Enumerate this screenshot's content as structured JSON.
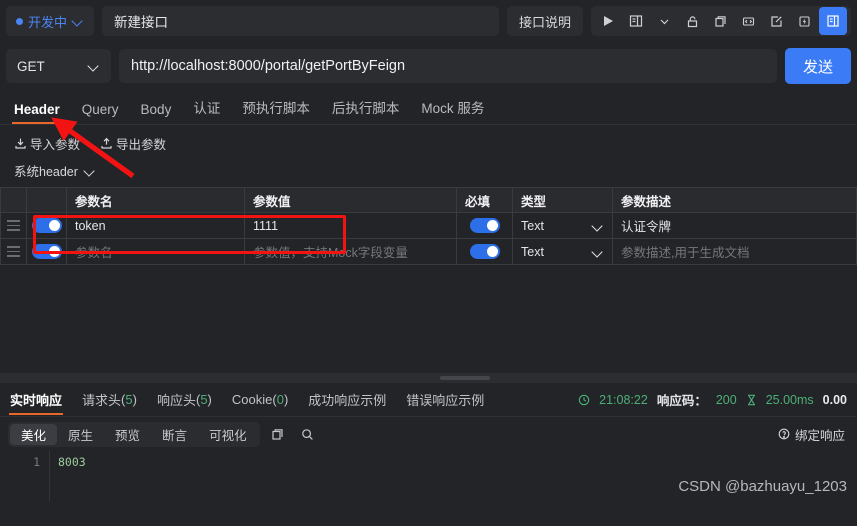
{
  "topbar": {
    "status_label": "开发中",
    "status_color": "#4a85f5",
    "title_value": "新建接口",
    "doc_button": "接口说明",
    "icons": [
      "run-icon",
      "doc-list-icon",
      "chevron-down-icon",
      "lock-icon",
      "copy-icon",
      "code-icon",
      "share-icon",
      "flash-icon",
      "save-icon"
    ]
  },
  "request": {
    "method": "GET",
    "url": "http://localhost:8000/portal/getPortByFeign",
    "send_label": "发送"
  },
  "tabs": [
    {
      "label": "Header",
      "active": true
    },
    {
      "label": "Query",
      "active": false
    },
    {
      "label": "Body",
      "active": false
    },
    {
      "label": "认证",
      "active": false
    },
    {
      "label": "预执行脚本",
      "active": false
    },
    {
      "label": "后执行脚本",
      "active": false
    },
    {
      "label": "Mock 服务",
      "active": false
    }
  ],
  "param_actions": {
    "import_label": "导入参数",
    "export_label": "导出参数",
    "system_header_label": "系统header"
  },
  "table": {
    "headers": {
      "name": "参数名",
      "value": "参数值",
      "required": "必填",
      "type": "类型",
      "description": "参数描述"
    },
    "rows": [
      {
        "enabled": true,
        "name": "token",
        "name_placeholder": "",
        "value": "1111",
        "value_placeholder": "",
        "required": true,
        "type": "Text",
        "description": "认证令牌",
        "description_placeholder": ""
      },
      {
        "enabled": true,
        "name": "",
        "name_placeholder": "参数名",
        "value": "",
        "value_placeholder": "参数值，支持Mock字段变量",
        "required": true,
        "type": "Text",
        "description": "",
        "description_placeholder": "参数描述,用于生成文档"
      }
    ]
  },
  "response": {
    "tabs": [
      {
        "label": "实时响应",
        "count": "",
        "active": true
      },
      {
        "label": "请求头",
        "count": "5",
        "active": false
      },
      {
        "label": "响应头",
        "count": "5",
        "active": false
      },
      {
        "label": "Cookie",
        "count": "0",
        "active": false
      },
      {
        "label": "成功响应示例",
        "count": "",
        "active": false
      },
      {
        "label": "错误响应示例",
        "count": "",
        "active": false
      }
    ],
    "meta": {
      "time": "21:08:22",
      "status_label": "响应码：",
      "status_code": "200",
      "duration": "25.00ms",
      "size": "0.00"
    },
    "view_modes": [
      {
        "label": "美化",
        "active": true
      },
      {
        "label": "原生",
        "active": false
      },
      {
        "label": "预览",
        "active": false
      },
      {
        "label": "断言",
        "active": false
      },
      {
        "label": "可视化",
        "active": false
      }
    ],
    "bind_label": "绑定响应",
    "body_lines": [
      {
        "num": "1",
        "text": "8003"
      }
    ]
  },
  "watermark": "CSDN @bazhuayu_1203"
}
